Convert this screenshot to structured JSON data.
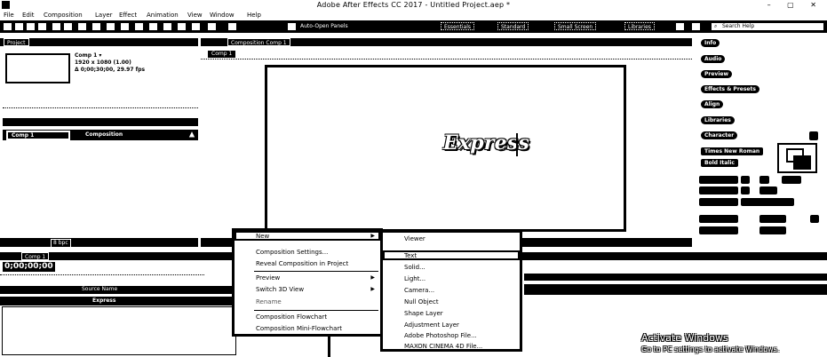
{
  "window": {
    "title": "Adobe After Effects CC 2017 - Untitled Project.aep *",
    "controls": "–  ▢  ✕"
  },
  "menu": [
    "File",
    "Edit",
    "Composition",
    "Layer",
    "Effect",
    "Animation",
    "View",
    "Window",
    "Help"
  ],
  "toolbar": {
    "auto_open": "Auto-Open Panels",
    "workspaces": [
      "Essentials",
      "Standard",
      "Small Screen",
      "Libraries"
    ],
    "search": "Search Help"
  },
  "project_panel": {
    "tab": "Project",
    "comp_name": "Comp 1 ▾",
    "comp_info_line1": "1920 x 1080 (1.00)",
    "comp_info_line2": "Δ 0;00;30;00, 29.97 fps",
    "item_name": "Comp 1",
    "item_type": "Composition",
    "bpc": "8 bpc"
  },
  "composition_panel": {
    "tab": "Composition Comp 1",
    "subtab": "Comp 1",
    "text_layer_content": "Express"
  },
  "right_panel": {
    "items": [
      "Info",
      "Audio",
      "Preview",
      "Effects & Presets",
      "Align",
      "Libraries",
      "Character"
    ],
    "font_name": "Times New Roman",
    "font_style": "Bold Italic"
  },
  "timeline": {
    "tab": "Comp 1",
    "timecode": "0;00;00;00",
    "layer_label": "Source Name",
    "layer_name": "Express"
  },
  "context_menu": {
    "items": [
      {
        "label": "New",
        "has_submenu": true
      },
      {
        "label": "Composition Settings...",
        "has_submenu": false
      },
      {
        "label": "Reveal Composition in Project",
        "has_submenu": false
      },
      {
        "label": "Preview",
        "has_submenu": true
      },
      {
        "label": "Switch 3D View",
        "has_submenu": true
      },
      {
        "label": "Rename",
        "has_submenu": false
      },
      {
        "label": "Composition Flowchart",
        "has_submenu": false
      },
      {
        "label": "Composition Mini-Flowchart",
        "has_submenu": false
      }
    ]
  },
  "submenu": {
    "items": [
      "Viewer",
      "Text",
      "Solid...",
      "Light...",
      "Camera...",
      "Null Object",
      "Shape Layer",
      "Adjustment Layer",
      "Adobe Photoshop File...",
      "MAXON CINEMA 4D File..."
    ]
  },
  "watermark": {
    "line1": "Activate Windows",
    "line2": "Go to PC settings to activate Windows."
  }
}
